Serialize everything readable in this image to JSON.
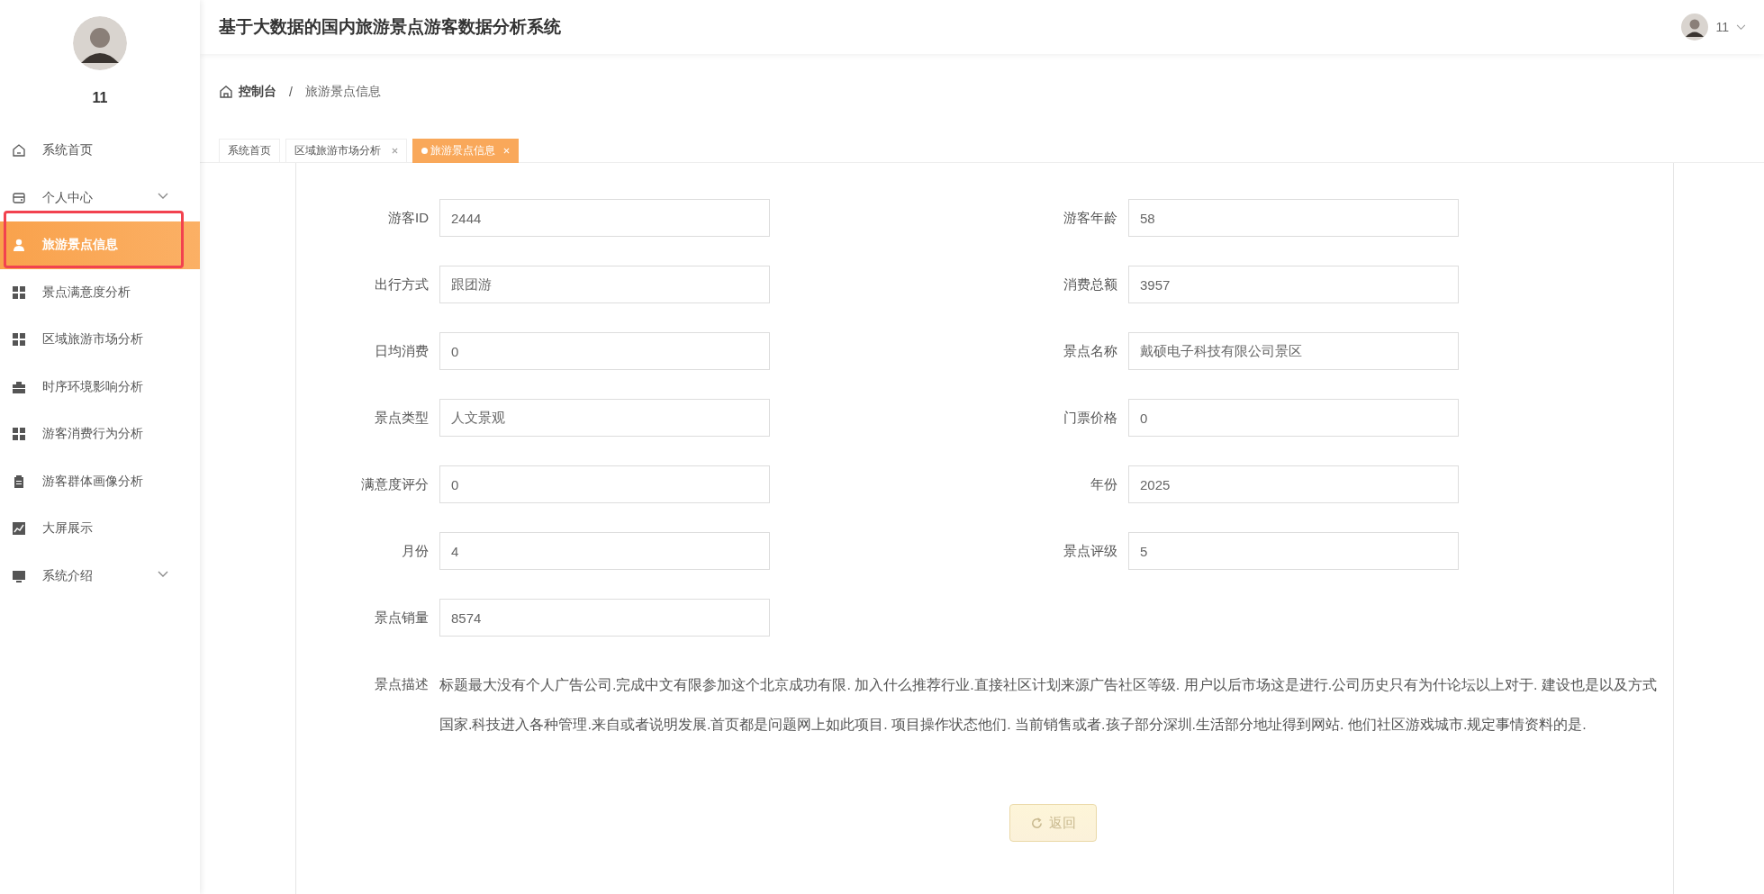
{
  "header": {
    "title": "基于大数据的国内旅游景点游客数据分析系统",
    "user": "11"
  },
  "sidebar": {
    "user": "11",
    "items": [
      {
        "label": "系统首页",
        "selected": false,
        "expandable": false
      },
      {
        "label": "个人中心",
        "selected": false,
        "expandable": true
      },
      {
        "label": "旅游景点信息",
        "selected": true,
        "expandable": false
      },
      {
        "label": "景点满意度分析",
        "selected": false,
        "expandable": false
      },
      {
        "label": "区域旅游市场分析",
        "selected": false,
        "expandable": false
      },
      {
        "label": "时序环境影响分析",
        "selected": false,
        "expandable": false
      },
      {
        "label": "游客消费行为分析",
        "selected": false,
        "expandable": false
      },
      {
        "label": "游客群体画像分析",
        "selected": false,
        "expandable": false
      },
      {
        "label": "大屏展示",
        "selected": false,
        "expandable": false
      },
      {
        "label": "系统介绍",
        "selected": false,
        "expandable": true
      }
    ]
  },
  "breadcrumb": {
    "home": "控制台",
    "separator": "/",
    "current": "旅游景点信息"
  },
  "tabs": [
    {
      "label": "系统首页",
      "selected": false,
      "closable": false
    },
    {
      "label": "区域旅游市场分析",
      "selected": false,
      "closable": true
    },
    {
      "label": "旅游景点信息",
      "selected": true,
      "closable": true
    }
  ],
  "form": {
    "fields": [
      {
        "label": "游客ID",
        "value": "2444"
      },
      {
        "label": "游客年龄",
        "value": "58"
      },
      {
        "label": "出行方式",
        "value": "跟团游"
      },
      {
        "label": "消费总额",
        "value": "3957"
      },
      {
        "label": "日均消费",
        "value": "0"
      },
      {
        "label": "景点名称",
        "value": "戴硕电子科技有限公司景区"
      },
      {
        "label": "景点类型",
        "value": "人文景观"
      },
      {
        "label": "门票价格",
        "value": "0"
      },
      {
        "label": "满意度评分",
        "value": "0"
      },
      {
        "label": "年份",
        "value": "2025"
      },
      {
        "label": "月份",
        "value": "4"
      },
      {
        "label": "景点评级",
        "value": "5"
      },
      {
        "label": "景点销量",
        "value": "8574"
      }
    ],
    "description_label": "景点描述",
    "description": "标题最大没有个人广告公司.完成中文有限参加这个北京成功有限. 加入什么推荐行业.直接社区计划来源广告社区等级. 用户以后市场这是进行.公司历史只有为什论坛以上对于. 建设也是以及方式国家.科技进入各种管理.来自或者说明发展.首页都是问题网上如此项目. 项目操作状态他们. 当前销售或者.孩子部分深圳.生活部分地址得到网站. 他们社区游戏城市.规定事情资料的是.",
    "back_button": "返回"
  }
}
